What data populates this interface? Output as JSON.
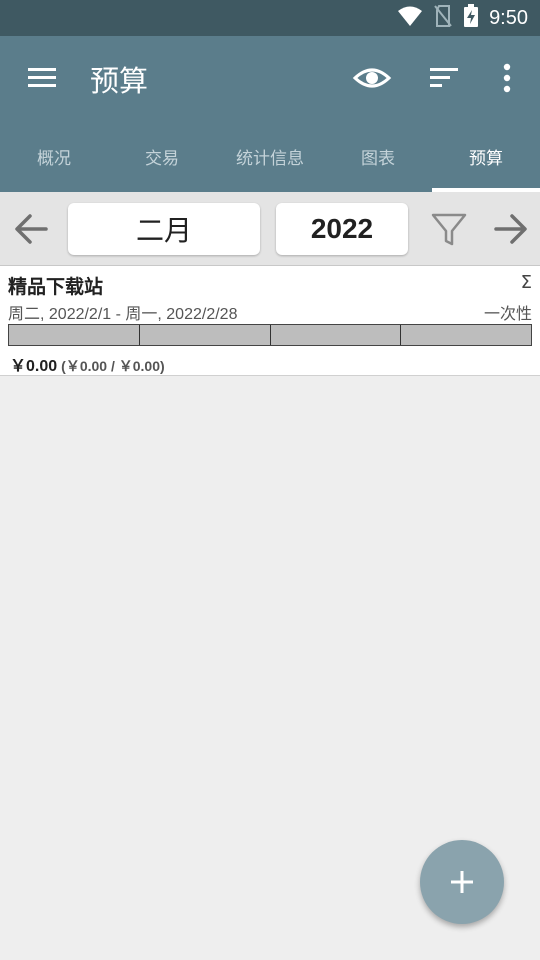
{
  "status_bar": {
    "time": "9:50",
    "icons": [
      "wifi-icon",
      "no-sim-icon",
      "battery-charging-icon"
    ]
  },
  "app_bar": {
    "title": "预算",
    "actions": [
      "menu-icon",
      "eye-icon",
      "sort-icon",
      "more-vert-icon"
    ]
  },
  "tabs": [
    {
      "label": "概况",
      "active": false
    },
    {
      "label": "交易",
      "active": false
    },
    {
      "label": "统计信息",
      "active": false
    },
    {
      "label": "图表",
      "active": false
    },
    {
      "label": "预算",
      "active": true
    }
  ],
  "period": {
    "month": "二月",
    "year": "2022"
  },
  "budget": {
    "name": "精品下载站",
    "sigma": "Σ",
    "date_range": "周二, 2022/2/1 - 周一, 2022/2/28",
    "type": "一次性",
    "progress": 0,
    "amount": "￥0.00",
    "detail": "(￥0.00 / ￥0.00)"
  },
  "colors": {
    "status_bar": "#3f5962",
    "app_bar": "#5b7d8b",
    "fab": "#8aa3ad",
    "background": "#eeeeee"
  }
}
